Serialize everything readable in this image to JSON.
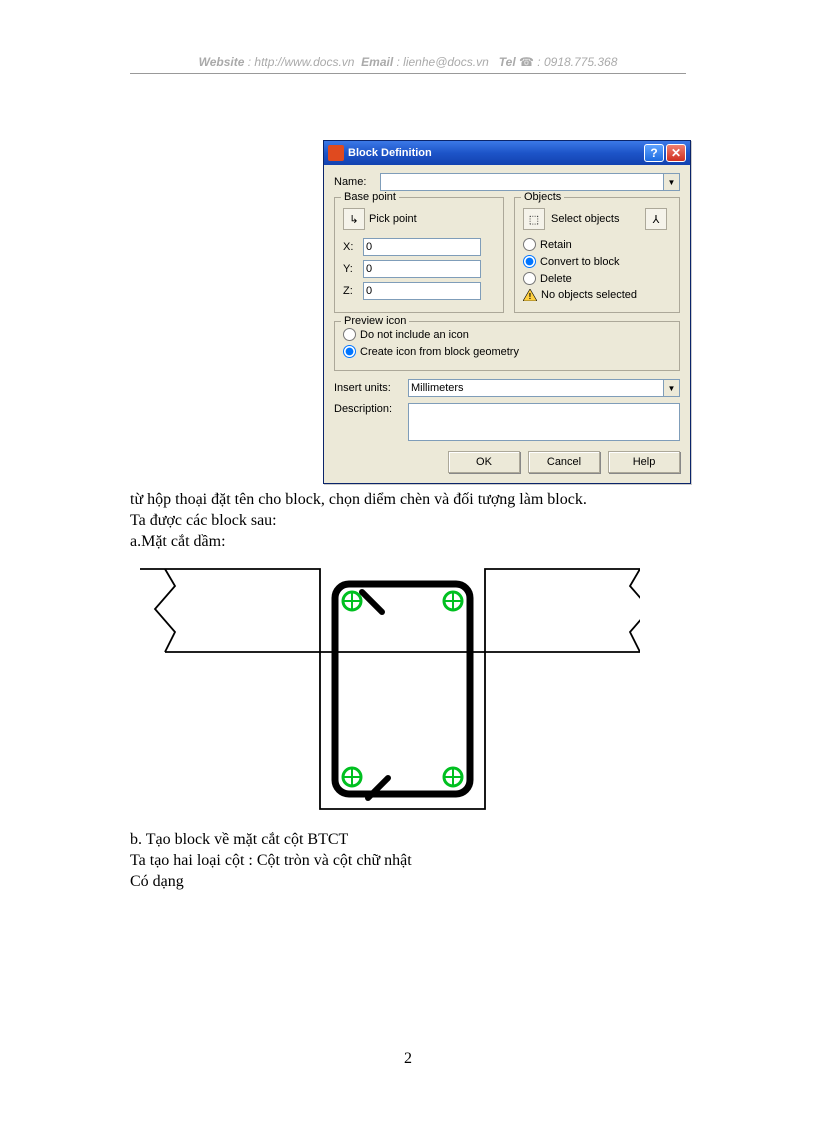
{
  "header": {
    "website_label": "Website",
    "website_sep": " : ",
    "website_url": "http://www.docs.vn",
    "email_label": "Email",
    "email_sep": "  : ",
    "email_value": "lienhe@docs.vn",
    "tel_label": "Tel",
    "tel_sep": " ",
    "phone_glyph": "☎",
    "tel_value": " : 0918.775.368"
  },
  "dialog": {
    "title": "Block Definition",
    "help_glyph": "?",
    "close_glyph": "✕",
    "name_label": "Name:",
    "name_value": "",
    "combo_glyph": "▼",
    "base_point": {
      "legend": "Base point",
      "pick_glyph": "↳",
      "pick_label": "Pick point",
      "x_label": "X:",
      "x_value": "0",
      "y_label": "Y:",
      "y_value": "0",
      "z_label": "Z:",
      "z_value": "0"
    },
    "objects": {
      "legend": "Objects",
      "select_glyph": "⬚",
      "select_label": "Select objects",
      "quick_glyph": "⅄",
      "retain": "Retain",
      "convert": "Convert to block",
      "delete": "Delete",
      "warn": "No objects selected"
    },
    "preview": {
      "legend": "Preview icon",
      "opt1": "Do not include an icon",
      "opt2": "Create icon from block geometry"
    },
    "insert_units_label": "Insert units:",
    "insert_units_value": "Millimeters",
    "description_label": "Description:",
    "description_value": "",
    "ok": "OK",
    "cancel": "Cancel",
    "help": "Help"
  },
  "body": {
    "p1": "từ hộp thoại đặt tên cho block, chọn diểm chèn và đối tượng làm block.",
    "p2": "Ta được các block sau:",
    "p3": "a.Mặt cắt dầm:",
    "p4": "b. Tạo block về mặt cắt cột BTCT",
    "p5": "Ta tạo hai loại cột : Cột tròn và cột chữ nhật",
    "p6": "Có dạng"
  },
  "page_number": "2"
}
